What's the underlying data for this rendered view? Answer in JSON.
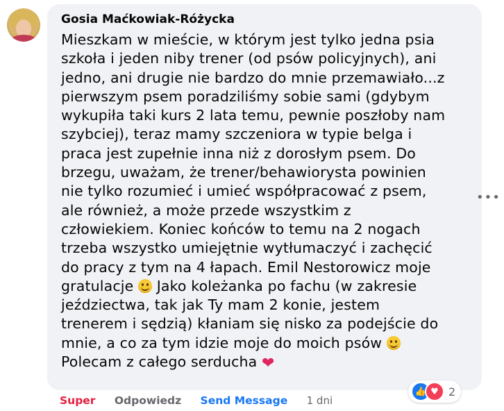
{
  "comment": {
    "author": "Gosia Maćkowiak-Różycka",
    "text_lines": [
      "Mieszkam w mieście, w którym jest tylko jedna psia",
      "szkoła i jeden niby trener (od psów policyjnych), ani",
      "jedno, ani drugie nie bardzo do mnie przemawiało...z",
      "pierwszym psem poradziliśmy sobie sami (gdybym",
      "wykupiła taki kurs 2 lata temu, pewnie poszłoby nam",
      "szybciej), teraz mamy szczeniora w typie belga i",
      "praca jest zupełnie inna niż z dorosłym psem. Do",
      "brzegu, uważam, że trener/behawiorysta powinien",
      "nie tylko rozumieć i umieć współpracować z psem,",
      "ale również, a może przede wszystkim z",
      "człowiekiem. Koniec końców to temu na 2 nogach",
      "trzeba wszystko umiejętnie wytłumaczyć i zachęcić",
      "do pracy z tym na 4 łapach. Emil Nestorowicz moje"
    ],
    "line_gratulacje": "gratulacje",
    "line_gratulacje_rest": "Jako koleżanka po fachu (w zakresie",
    "text_lines_2": [
      "jeździectwa, tak jak Ty mam 2 konie, jestem",
      "trenerem i sędzią) kłaniam się nisko za podejście do"
    ],
    "line_psow": "mnie, a co za tym idzie moje do moich psów",
    "line_last": "Polecam z całego serducha",
    "emoji_smile": "smile-emoji",
    "emoji_heart": "heart-emoji"
  },
  "actions": {
    "like": "Super",
    "reply": "Odpowiedz",
    "send": "Send Message",
    "time": "1 dni"
  },
  "reactions": {
    "count": "2",
    "icons": [
      "like-icon",
      "love-icon"
    ]
  },
  "more_label": "•••",
  "colors": {
    "bubble": "#f0f2f5",
    "like_red": "#e41e3f",
    "send_blue": "#1877f2",
    "muted": "#65676b"
  }
}
